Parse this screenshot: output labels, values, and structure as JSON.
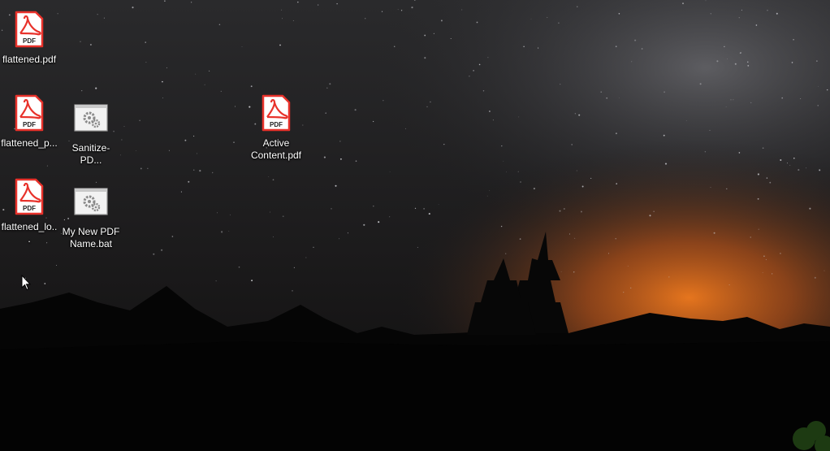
{
  "desktop": {
    "icons": [
      {
        "label": "flattened.pdf",
        "type": "pdf-file-icon"
      },
      {
        "label": "flattened_p...",
        "type": "pdf-file-icon"
      },
      {
        "label": "Sanitize-PD...",
        "type": "batch-file-icon"
      },
      {
        "label": "Active Content.pdf",
        "type": "pdf-file-icon"
      },
      {
        "label": "flattened_lo...",
        "type": "pdf-file-icon"
      },
      {
        "label": "My New PDF Name.bat",
        "type": "batch-file-icon"
      }
    ],
    "pdf_badge": "PDF",
    "colors": {
      "pdf_red": "#e8322b",
      "glow": "#d9661c"
    }
  }
}
